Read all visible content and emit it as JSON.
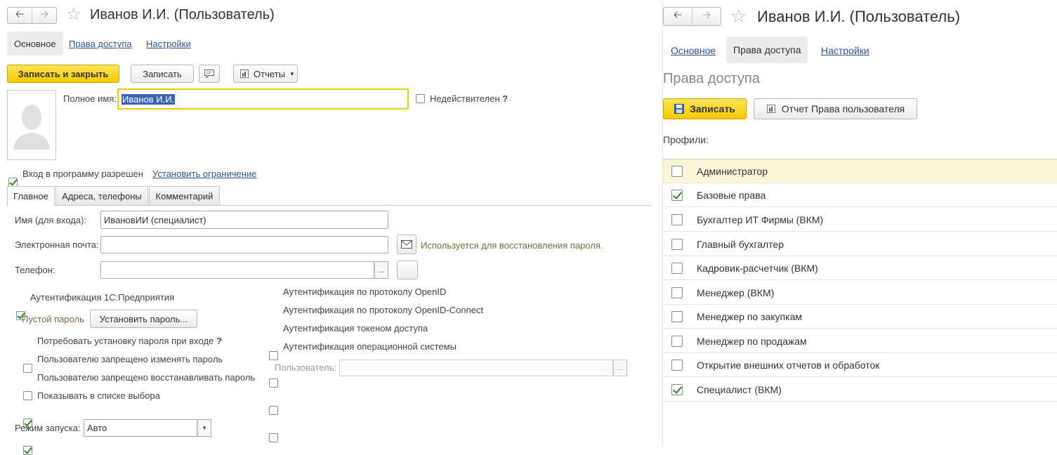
{
  "left": {
    "window_title": "Иванов И.И. (Пользователь)",
    "tabs": [
      "Основное",
      "Права доступа",
      "Настройки"
    ],
    "toolbar": {
      "save_close": "Записать и закрыть",
      "save": "Записать",
      "reports": "Отчеты"
    },
    "full_name_label": "Полное имя:",
    "full_name_value": "Иванов И.И.",
    "invalid_label": "Недействителен",
    "help_mark": "?",
    "login_allowed_label": "Вход в программу разрешен",
    "login_allowed_checked": true,
    "set_restriction_link": "Установить ограничение",
    "inner_tabs": [
      "Главное",
      "Адреса, телефоны",
      "Комментарий"
    ],
    "login_name_label": "Имя (для входа):",
    "login_name_value": "ИвановИИ (специалист)",
    "email_label": "Электронная почта:",
    "email_value": "",
    "email_hint": "Используется для восстановления пароля.",
    "phone_label": "Телефон:",
    "phone_value": "",
    "ellipsis": "...",
    "auth_1c_label": "Аутентификация 1С:Предприятия",
    "auth_1c_checked": true,
    "empty_password_label": "Пустой пароль",
    "set_password_button": "Установить пароль...",
    "password_options": [
      {
        "label": "Потребовать установку пароля при входе",
        "checked": false
      },
      {
        "label": "Пользователю запрещено изменять пароль",
        "checked": false
      },
      {
        "label": "Пользователю запрещено восстанавливать пароль",
        "checked": true
      },
      {
        "label": "Показывать в списке выбора",
        "checked": true
      }
    ],
    "auth_options": [
      {
        "label": "Аутентификация по протоколу OpenID",
        "checked": false
      },
      {
        "label": "Аутентификация по протоколу OpenID-Connect",
        "checked": false
      },
      {
        "label": "Аутентификация токеном доступа",
        "checked": false
      },
      {
        "label": "Аутентификация операционной системы",
        "checked": false
      }
    ],
    "os_user_label": "Пользователь:",
    "os_user_value": "",
    "launch_mode_label": "Режим запуска:",
    "launch_mode_value": "Авто"
  },
  "right": {
    "window_title": "Иванов И.И. (Пользователь)",
    "tabs": [
      "Основное",
      "Права доступа",
      "Настройки"
    ],
    "section_title": "Права доступа",
    "save_button": "Записать",
    "report_button": "Отчет Права пользователя",
    "profiles_label": "Профили:",
    "profiles": [
      {
        "label": "Администратор",
        "checked": false
      },
      {
        "label": "Базовые права",
        "checked": true
      },
      {
        "label": "Бухгалтер ИТ Фирмы (ВКМ)",
        "checked": false
      },
      {
        "label": "Главный бухгалтер",
        "checked": false
      },
      {
        "label": "Кадровик-расчетчик (ВКМ)",
        "checked": false
      },
      {
        "label": "Менеджер (ВКМ)",
        "checked": false
      },
      {
        "label": "Менеджер по закупкам",
        "checked": false
      },
      {
        "label": "Менеджер по продажам",
        "checked": false
      },
      {
        "label": "Открытие внешних отчетов и обработок",
        "checked": false
      },
      {
        "label": "Специалист (ВКМ)",
        "checked": true
      }
    ]
  },
  "colors": {
    "accent_yellow": "#f5c900",
    "link_blue": "#2a55a0",
    "selected_row": "#fdf5d8"
  }
}
